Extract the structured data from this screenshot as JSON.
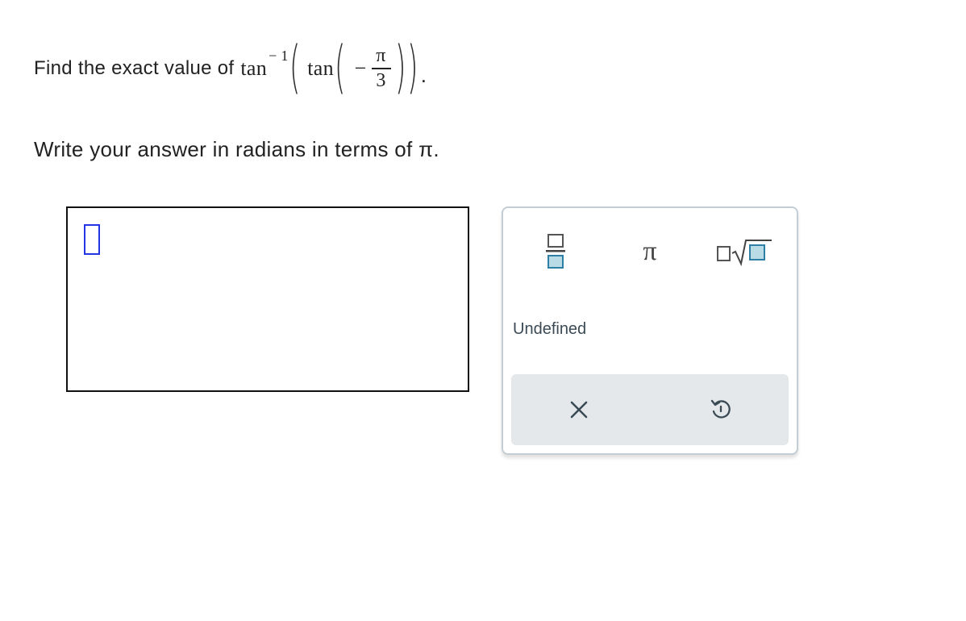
{
  "question": {
    "prefix": "Find the exact value of",
    "outer_fn": "tan",
    "outer_exponent": "− 1",
    "inner_fn": "tan",
    "minus": "−",
    "numerator": "π",
    "denominator": "3",
    "period": "."
  },
  "instruction": "Write your answer in radians in terms of π.",
  "answer": {
    "value": ""
  },
  "keypad": {
    "fraction_icon": "fraction-icon",
    "pi_label": "π",
    "sqrt_icon": "square-root-icon",
    "undefined_label": "Undefined",
    "clear_icon": "close-icon",
    "undo_icon": "undo-icon"
  },
  "colors": {
    "cursor": "#2236e6",
    "icon_fill": "#b9dbe6",
    "icon_stroke": "#2e7fa6",
    "action_bar": "#e4e8ea",
    "keypad_border": "#c3cdd3"
  }
}
